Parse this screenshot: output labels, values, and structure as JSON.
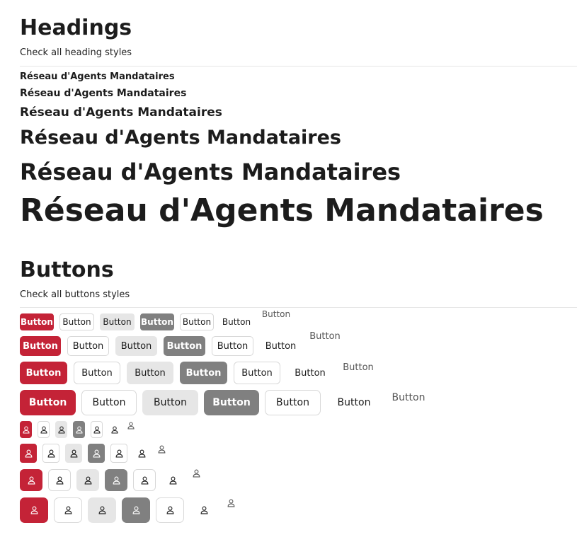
{
  "headings_section": {
    "title": "Headings",
    "subtitle": "Check all heading styles",
    "samples": [
      "Réseau d'Agents Mandataires",
      "Réseau d'Agents Mandataires",
      "Réseau d'Agents Mandataires",
      "Réseau d'Agents Mandataires",
      "Réseau d'Agents Mandataires",
      "Réseau d'Agents Mandataires"
    ]
  },
  "buttons_section": {
    "title": "Buttons",
    "subtitle": "Check all buttons styles",
    "button_label": "Button",
    "icon_name": "user-icon"
  },
  "colors": {
    "primary": "#c42337",
    "dark": "#808080",
    "light": "#e6e6e6",
    "border": "#d8d8d8"
  }
}
